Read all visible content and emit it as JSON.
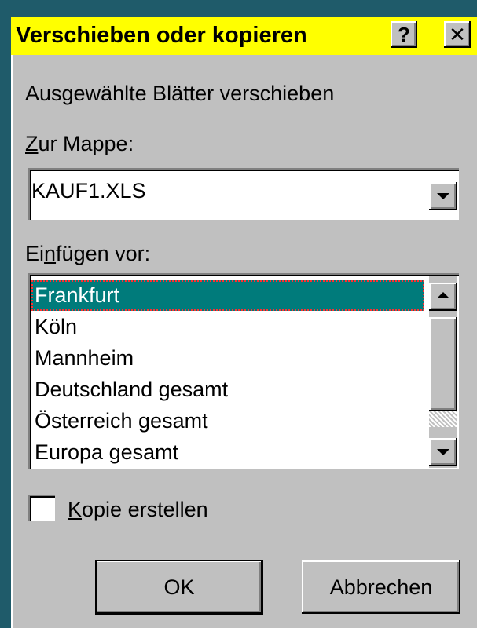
{
  "dialog": {
    "title": "Verschieben oder kopieren",
    "help_button": "?",
    "close_button": "✕",
    "description": "Ausgewählte Blätter verschieben",
    "to_book_label": "Zur Mappe:",
    "to_book_value": "KAUF1.XLS",
    "insert_before_label": "Einfügen vor:",
    "sheets": [
      "Frankfurt",
      "Köln",
      "Mannheim",
      "Deutschland gesamt",
      "Österreich gesamt",
      "Europa gesamt"
    ],
    "selected_sheet_index": 0,
    "copy_checkbox_label": "Kopie erstellen",
    "copy_checked": false,
    "ok_label": "OK",
    "cancel_label": "Abbrechen"
  },
  "colors": {
    "title_bar": "#ffff00",
    "dialog_face": "#c0c0c0",
    "selection": "#007b7b",
    "desktop": "#1f5b6a"
  },
  "icons": {
    "dropdown": "chevron-down-icon",
    "scroll_up": "chevron-up-icon",
    "scroll_down": "chevron-down-icon"
  }
}
